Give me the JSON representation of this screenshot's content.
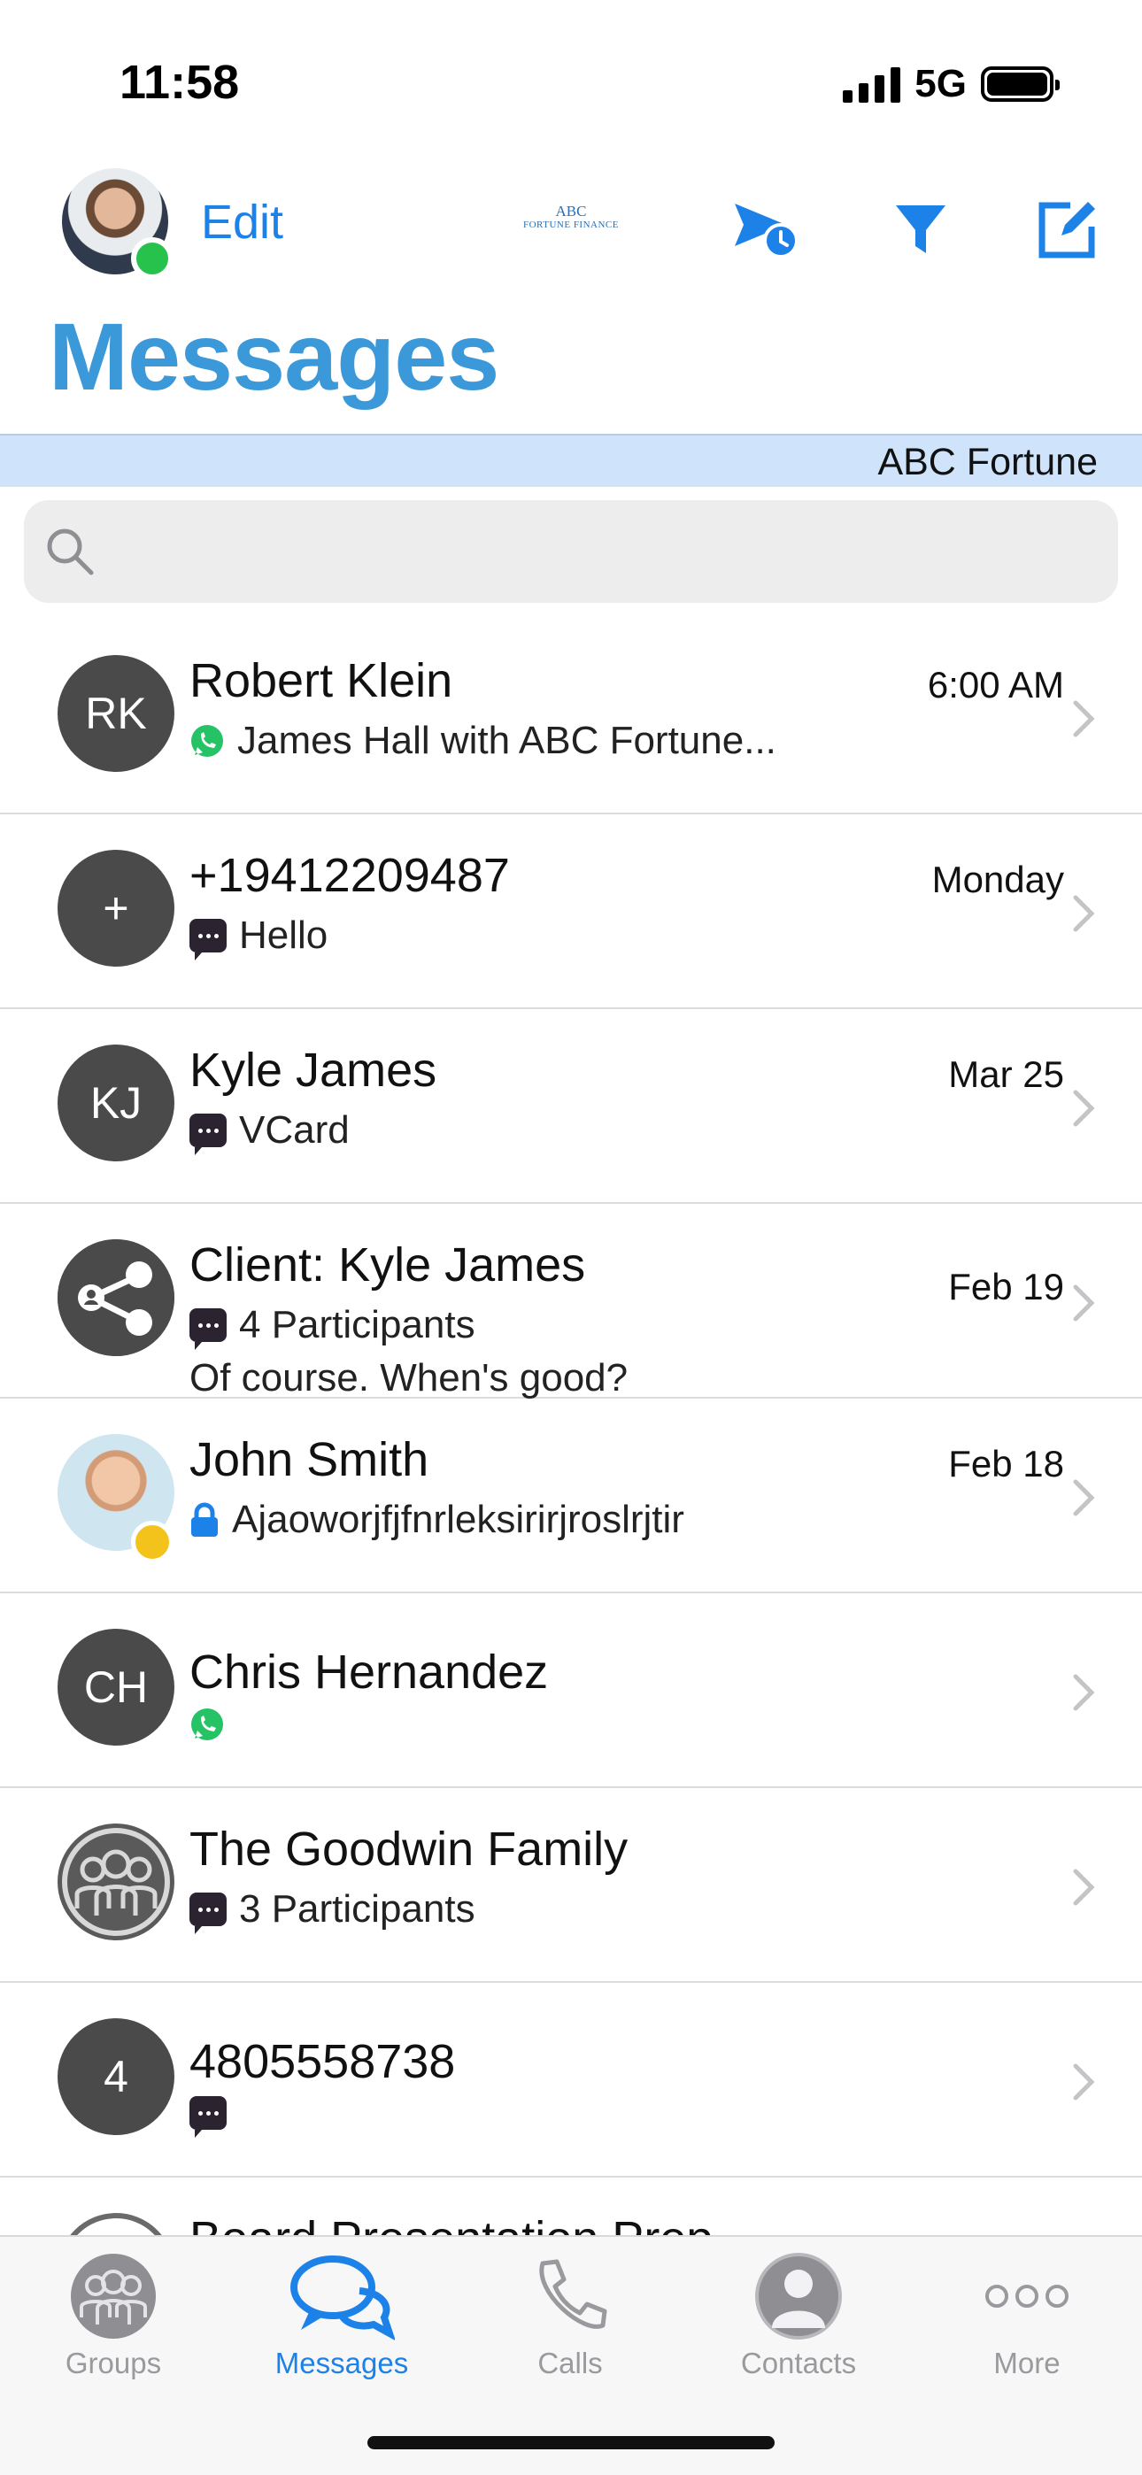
{
  "status_bar": {
    "time": "11:58",
    "network": "5G"
  },
  "header": {
    "edit_label": "Edit",
    "brand_line1": "ABC",
    "brand_line2": "FORTUNE FINANCE",
    "title": "Messages"
  },
  "org_banner": {
    "label": "ABC Fortune"
  },
  "search": {
    "placeholder": ""
  },
  "conversations": [
    {
      "name": "Robert Klein",
      "initials": "RK",
      "preview": "James Hall with ABC Fortune...",
      "date": "6:00 AM",
      "channel": "whatsapp-icon"
    },
    {
      "name": "+19412209487",
      "initials": "+",
      "preview": "Hello",
      "date": "Monday",
      "channel": "message-icon"
    },
    {
      "name": "Kyle James",
      "initials": "KJ",
      "preview": "VCard",
      "date": "Mar 25",
      "channel": "message-icon"
    },
    {
      "name": "Client: Kyle James",
      "preview": "4 Participants",
      "preview2": "Of course. When's good?",
      "date": "Feb 19",
      "channel": "message-icon",
      "avatar": "share-icon"
    },
    {
      "name": "John Smith",
      "preview": "Ajaoworjfjfnrleksirirjroslrjtir",
      "date": "Feb 18",
      "channel": "lock-icon",
      "avatar": "photo"
    },
    {
      "name": "Chris Hernandez",
      "initials": "CH",
      "preview": "",
      "date": "",
      "channel": "whatsapp-icon"
    },
    {
      "name": "The Goodwin Family",
      "preview": "3 Participants",
      "date": "",
      "channel": "message-icon",
      "avatar": "group-icon"
    },
    {
      "name": "4805558738",
      "initials": "4",
      "preview": "",
      "date": "",
      "channel": "message-icon"
    },
    {
      "name": "Board Presentation Prep",
      "preview": "",
      "date": ""
    }
  ],
  "tabbar": {
    "tabs": [
      {
        "label": "Groups",
        "icon": "groups-icon"
      },
      {
        "label": "Messages",
        "icon": "messages-icon",
        "active": true
      },
      {
        "label": "Calls",
        "icon": "phone-icon"
      },
      {
        "label": "Contacts",
        "icon": "contact-icon"
      },
      {
        "label": "More",
        "icon": "more-icon"
      }
    ]
  },
  "colors": {
    "accent": "#1d82e8",
    "title": "#3b98d9",
    "banner": "#cfe3fb",
    "avatar": "#4a4a4a",
    "online": "#27c24c",
    "away": "#f3c31b",
    "whatsapp": "#25c266"
  }
}
